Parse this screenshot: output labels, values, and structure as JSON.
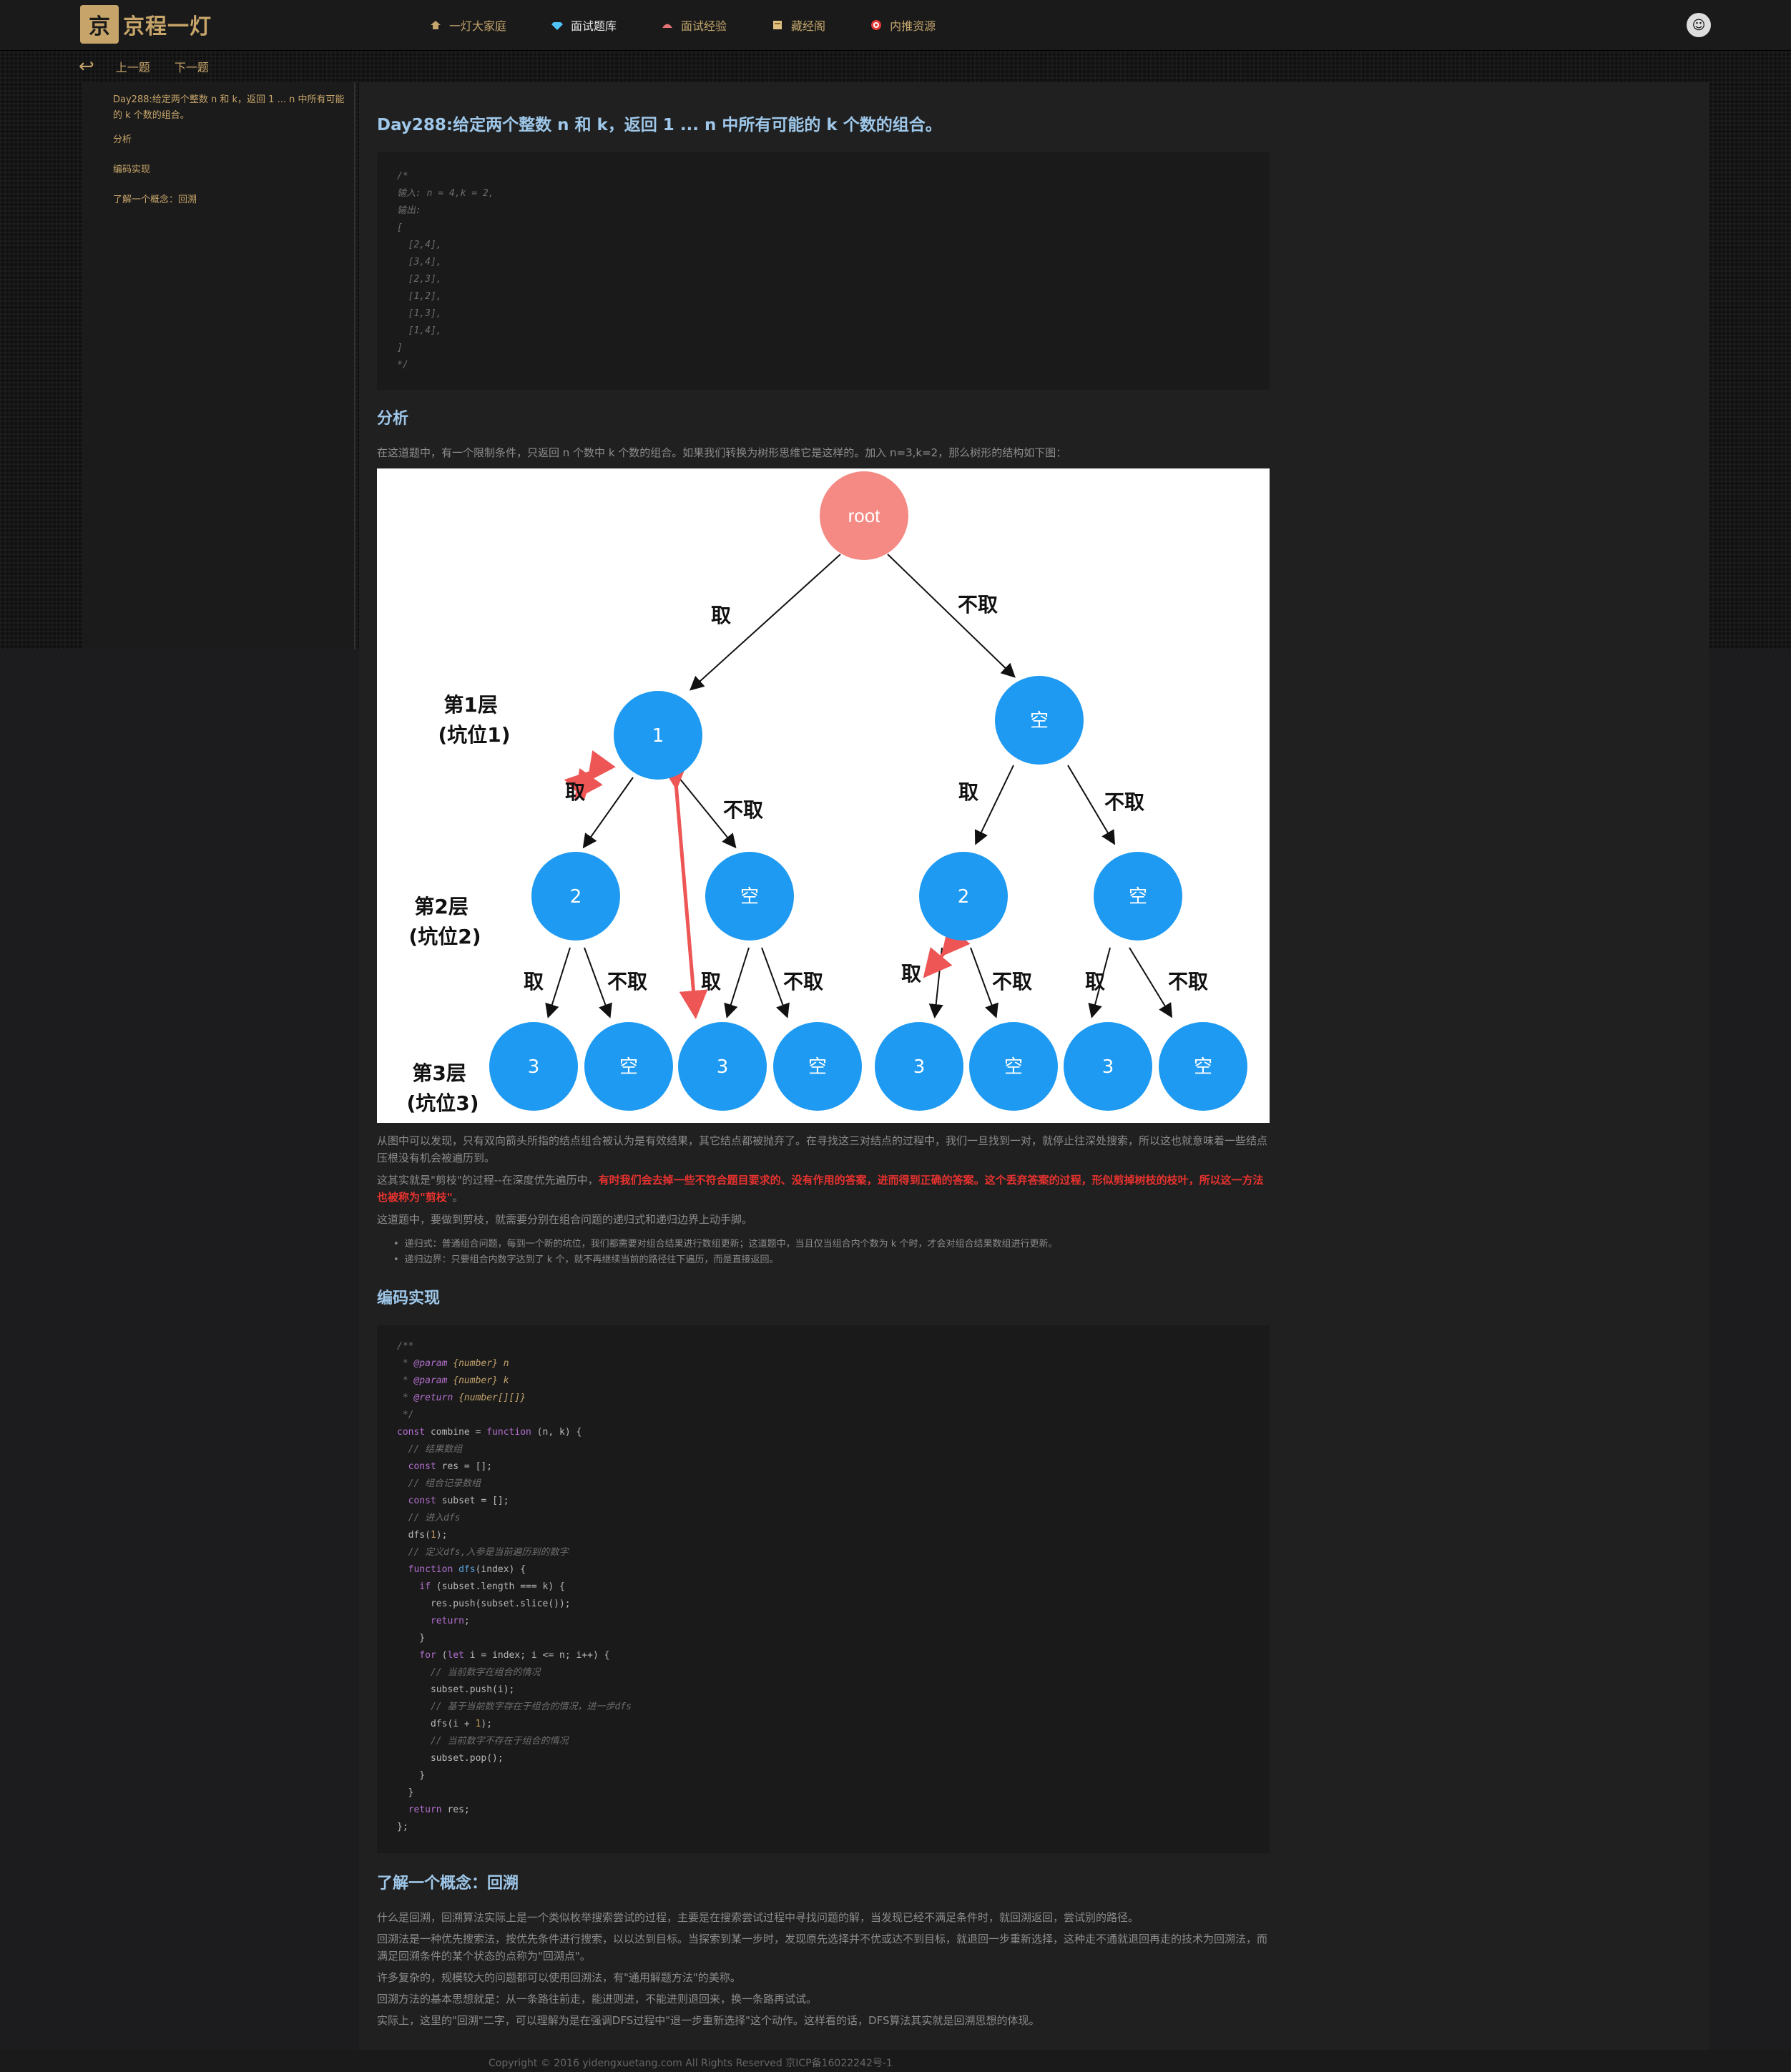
{
  "brand": {
    "mark": "京",
    "name": "京程一灯"
  },
  "nav": [
    {
      "label": "一灯大家庭",
      "icon": "home-icon"
    },
    {
      "label": "面试题库",
      "icon": "diamond-icon"
    },
    {
      "label": "面试经验",
      "icon": "hat-icon"
    },
    {
      "label": "藏经阁",
      "icon": "book-icon"
    },
    {
      "label": "内推资源",
      "icon": "target-icon"
    }
  ],
  "subnav": {
    "prev": "上一题",
    "next": "下一题"
  },
  "toc": [
    "Day288:给定两个整数 n 和 k，返回 1 ... n 中所有可能的 k 个数的组合。",
    "分析",
    "编码实现",
    "了解一个概念：回溯"
  ],
  "article": {
    "title": "Day288:给定两个整数 n 和 k，返回 1 ... n 中所有可能的 k 个数的组合。",
    "example_code": [
      "/*",
      "输入: n = 4,k = 2,",
      "输出:",
      "[",
      "  [2,4],",
      "  [3,4],",
      "  [2,3],",
      "  [1,2],",
      "  [1,3],",
      "  [1,4],",
      "]",
      "*/"
    ],
    "analysis_title": "分析",
    "analysis_intro": "在这道题中，有一个限制条件，只返回 n 个数中 k 个数的组合。如果我们转换为树形思维它是这样的。加入 n=3,k=2，那么树形的结构如下图：",
    "tree": {
      "root": "root",
      "take": "取",
      "skip": "不取",
      "level1": "第1层\n(坑位1)",
      "level2": "第2层\n(坑位2)",
      "level3": "第3层\n(坑位3)",
      "n1": "1",
      "empty": "空",
      "n2": "2",
      "n3": "3"
    },
    "para1": "从图中可以发现，只有双向箭头所指的结点组合被认为是有效结果，其它结点都被抛弃了。在寻找这三对结点的过程中，我们一旦找到一对，就停止往深处搜索，所以这也就意味着一些结点压根没有机会被遍历到。",
    "para2_a": "这其实就是\"剪枝\"的过程--在深度优先遍历中，",
    "para2_b": "有时我们会去掉一些不符合题目要求的、没有作用的答案，进而得到正确的答案。这个丢弃答案的过程，形似剪掉树枝的枝叶，所以这一方法也被称为\"剪枝\"",
    "para2_c": "。",
    "para3": "这道题中，要做到剪枝，就需要分别在组合问题的递归式和递归边界上动手脚。",
    "bullets": [
      "递归式：普通组合问题，每到一个新的坑位，我们都需要对组合结果进行数组更新；这道题中，当且仅当组合内个数为 k 个时，才会对组合结果数组进行更新。",
      "递归边界：只要组合内数字达到了 k 个，就不再继续当前的路径往下遍历，而是直接返回。"
    ],
    "coding_title": "编码实现",
    "code": {
      "c1": "/**",
      "c2_tag": "@param",
      "c2_type": "{number}",
      "c2_name": "n",
      "c3_tag": "@param",
      "c3_type": "{number}",
      "c3_name": "k",
      "c4_tag": "@return",
      "c4_type": "{number[][]}",
      "c5": " */",
      "l1_kw": "const",
      "l1_a": " combine = ",
      "l1_fn": "function",
      "l1_b": " (n, k) {",
      "l2": "  // 结果数组",
      "l3_kw": "  const",
      "l3_b": " res = [];",
      "l4": "  // 组合记录数组",
      "l5_kw": "  const",
      "l5_b": " subset = [];",
      "l6": "  // 进入dfs",
      "l7_a": "  dfs(",
      "l7_n": "1",
      "l7_b": ");",
      "l8": "  // 定义dfs,入参是当前遍历到的数字",
      "l9_kw": "  function",
      "l9_fn": " dfs",
      "l9_b": "(index) {",
      "l10_kw": "    if",
      "l10_b": " (subset.length === k) {",
      "l11": "      res.push(subset.slice());",
      "l12_kw": "      return",
      "l12_b": ";",
      "l13": "    }",
      "l14_kw": "    for",
      "l14_b": " (",
      "l14_kw2": "let",
      "l14_c": " i = index; i <= n; i++) {",
      "l15": "      // 当前数字在组合的情况",
      "l16": "      subset.push(i);",
      "l17": "      // 基于当前数字存在于组合的情况，进一步dfs",
      "l18_a": "      dfs(i + ",
      "l18_n": "1",
      "l18_b": ");",
      "l19": "      // 当前数字不存在于组合的情况",
      "l20": "      subset.pop();",
      "l21": "    }",
      "l22": "  }",
      "l23_kw": "  return",
      "l23_b": " res;",
      "l24": "};"
    },
    "concept_title": "了解一个概念：回溯",
    "concept_paras": [
      "什么是回溯，回溯算法实际上是一个类似枚举搜索尝试的过程，主要是在搜索尝试过程中寻找问题的解，当发现已经不满足条件时，就回溯返回，尝试别的路径。",
      "回溯法是一种优先搜索法，按优先条件进行搜索，以以达到目标。当探索到某一步时，发现原先选择并不优或达不到目标，就退回一步重新选择，这种走不通就退回再走的技术为回溯法，而满足回溯条件的某个状态的点称为\"回溯点\"。",
      "许多复杂的，规模较大的问题都可以使用回溯法，有\"通用解题方法\"的美称。",
      "回溯方法的基本思想就是：从一条路往前走，能进则进，不能进则退回来，换一条路再试试。",
      "实际上，这里的\"回溯\"二字，可以理解为是在强调DFS过程中\"退一步重新选择\"这个动作。这样看的话，DFS算法其实就是回溯思想的体现。"
    ]
  },
  "footer": "Copyright © 2016 yidengxuetang.com All Rights Reserved 京ICP备16022242号-1",
  "colors": {
    "accent": "#c7a56a",
    "heading": "#9ec7e9",
    "node": "#1e9af2",
    "root": "#f58a84",
    "highlight": "#e8322f"
  }
}
